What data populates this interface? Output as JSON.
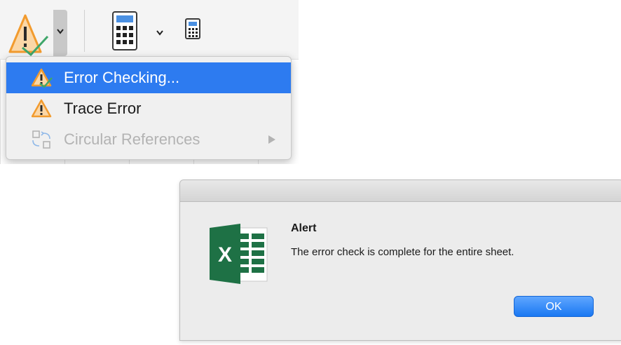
{
  "ribbon": {
    "error_checking_button": {
      "icon": "warning-check-icon"
    },
    "calculate_options_button": {
      "icon": "calculator-icon"
    },
    "calculate_now_button": {
      "icon": "small-calculator-icon"
    }
  },
  "dropdown": {
    "items": [
      {
        "label": "Error Checking...",
        "icon": "error-checking-icon",
        "state": "selected"
      },
      {
        "label": "Trace Error",
        "icon": "warning-icon",
        "state": "enabled"
      },
      {
        "label": "Circular References",
        "icon": "circular-references-icon",
        "state": "disabled",
        "submenu": true
      }
    ]
  },
  "alert": {
    "title": "Alert",
    "message": "The error check is complete for the entire sheet.",
    "ok_label": "OK",
    "app_icon": "excel-icon"
  },
  "colors": {
    "selection": "#2d7bf0",
    "warning": "#f5a623",
    "excel_green": "#1e7145",
    "ok_button": "#1a78f2"
  }
}
